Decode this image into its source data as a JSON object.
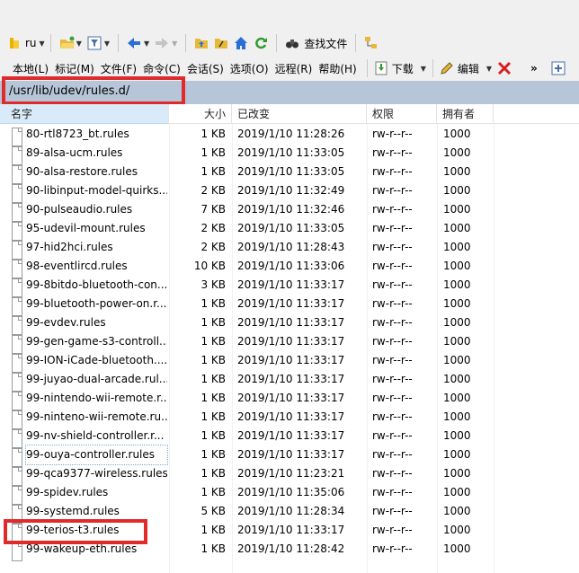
{
  "toolbar": {
    "location": "ru",
    "find_files": "查找文件"
  },
  "menu": {
    "items": [
      "本地(L)",
      "标记(M)",
      "文件(F)",
      "命令(C)",
      "会话(S)",
      "选项(O)",
      "远程(R)",
      "帮助(H)"
    ],
    "download": "下载",
    "edit": "编辑",
    "overflow": "»"
  },
  "path": "/usr/lib/udev/rules.d/",
  "columns": {
    "name": "名字",
    "size": "大小",
    "modified": "已改变",
    "permissions": "权限",
    "owner": "拥有者"
  },
  "files": [
    {
      "name": "80-rtl8723_bt.rules",
      "size": "1 KB",
      "modified": "2019/1/10 11:28:26",
      "perm": "rw-r--r--",
      "owner": "1000"
    },
    {
      "name": "89-alsa-ucm.rules",
      "size": "1 KB",
      "modified": "2019/1/10 11:33:05",
      "perm": "rw-r--r--",
      "owner": "1000"
    },
    {
      "name": "90-alsa-restore.rules",
      "size": "1 KB",
      "modified": "2019/1/10 11:33:05",
      "perm": "rw-r--r--",
      "owner": "1000"
    },
    {
      "name": "90-libinput-model-quirks...",
      "size": "2 KB",
      "modified": "2019/1/10 11:32:49",
      "perm": "rw-r--r--",
      "owner": "1000"
    },
    {
      "name": "90-pulseaudio.rules",
      "size": "7 KB",
      "modified": "2019/1/10 11:32:46",
      "perm": "rw-r--r--",
      "owner": "1000"
    },
    {
      "name": "95-udevil-mount.rules",
      "size": "2 KB",
      "modified": "2019/1/10 11:33:05",
      "perm": "rw-r--r--",
      "owner": "1000"
    },
    {
      "name": "97-hid2hci.rules",
      "size": "2 KB",
      "modified": "2019/1/10 11:28:43",
      "perm": "rw-r--r--",
      "owner": "1000"
    },
    {
      "name": "98-eventlircd.rules",
      "size": "10 KB",
      "modified": "2019/1/10 11:33:06",
      "perm": "rw-r--r--",
      "owner": "1000"
    },
    {
      "name": "99-8bitdo-bluetooth-con...",
      "size": "3 KB",
      "modified": "2019/1/10 11:33:17",
      "perm": "rw-r--r--",
      "owner": "1000"
    },
    {
      "name": "99-bluetooth-power-on.r...",
      "size": "1 KB",
      "modified": "2019/1/10 11:33:17",
      "perm": "rw-r--r--",
      "owner": "1000"
    },
    {
      "name": "99-evdev.rules",
      "size": "1 KB",
      "modified": "2019/1/10 11:33:17",
      "perm": "rw-r--r--",
      "owner": "1000"
    },
    {
      "name": "99-gen-game-s3-controll...",
      "size": "1 KB",
      "modified": "2019/1/10 11:33:17",
      "perm": "rw-r--r--",
      "owner": "1000"
    },
    {
      "name": "99-ION-iCade-bluetooth....",
      "size": "1 KB",
      "modified": "2019/1/10 11:33:17",
      "perm": "rw-r--r--",
      "owner": "1000"
    },
    {
      "name": "99-juyao-dual-arcade.rul...",
      "size": "1 KB",
      "modified": "2019/1/10 11:33:17",
      "perm": "rw-r--r--",
      "owner": "1000"
    },
    {
      "name": "99-nintendo-wii-remote.r...",
      "size": "1 KB",
      "modified": "2019/1/10 11:33:17",
      "perm": "rw-r--r--",
      "owner": "1000"
    },
    {
      "name": "99-ninteno-wii-remote.ru...",
      "size": "1 KB",
      "modified": "2019/1/10 11:33:17",
      "perm": "rw-r--r--",
      "owner": "1000"
    },
    {
      "name": "99-nv-shield-controller.r...",
      "size": "1 KB",
      "modified": "2019/1/10 11:33:17",
      "perm": "rw-r--r--",
      "owner": "1000"
    },
    {
      "name": "99-ouya-controller.rules",
      "size": "1 KB",
      "modified": "2019/1/10 11:33:17",
      "perm": "rw-r--r--",
      "owner": "1000"
    },
    {
      "name": "99-qca9377-wireless.rules",
      "size": "1 KB",
      "modified": "2019/1/10 11:23:21",
      "perm": "rw-r--r--",
      "owner": "1000"
    },
    {
      "name": "99-spidev.rules",
      "size": "1 KB",
      "modified": "2019/1/10 11:35:06",
      "perm": "rw-r--r--",
      "owner": "1000"
    },
    {
      "name": "99-systemd.rules",
      "size": "5 KB",
      "modified": "2019/1/10 11:28:34",
      "perm": "rw-r--r--",
      "owner": "1000"
    },
    {
      "name": "99-terios-t3.rules",
      "size": "1 KB",
      "modified": "2019/1/10 11:33:17",
      "perm": "rw-r--r--",
      "owner": "1000"
    },
    {
      "name": "99-wakeup-eth.rules",
      "size": "1 KB",
      "modified": "2019/1/10 11:28:42",
      "perm": "rw-r--r--",
      "owner": "1000"
    }
  ],
  "colors": {
    "path_bar": "#b6c6d8",
    "highlight_box": "#e02b2b",
    "header_selected": "#d9ebf9"
  }
}
